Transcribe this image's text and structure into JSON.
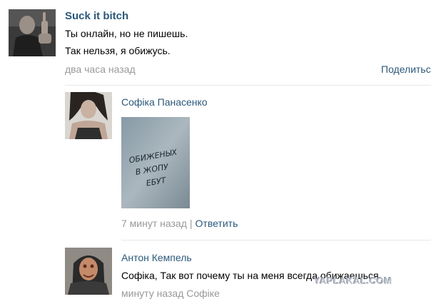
{
  "post": {
    "author": "Suck it bitch",
    "lines": [
      "Ты онлайн, но не пишешь.",
      "Так нельзя, я обижусь."
    ],
    "time": "два часа назад",
    "share_label": "Поделитьс"
  },
  "comments": [
    {
      "name": "Софіка Панасенко",
      "image_text": [
        "ОБИЖЕНЫХ",
        "В ЖОПУ",
        "ЕБУТ"
      ],
      "time": "7 минут назад",
      "separator": "|",
      "reply_label": "Ответить"
    },
    {
      "name": "Антон Кемпель",
      "text": "Софіка, Так вот почему ты на меня всегда обижаешься",
      "time": "минуту назад",
      "reply_to": "Софіке"
    }
  ],
  "watermark": "YAPLAKAL.COM",
  "colors": {
    "link": "#2b587a",
    "meta": "#999999",
    "divider": "#e7e8ec"
  }
}
